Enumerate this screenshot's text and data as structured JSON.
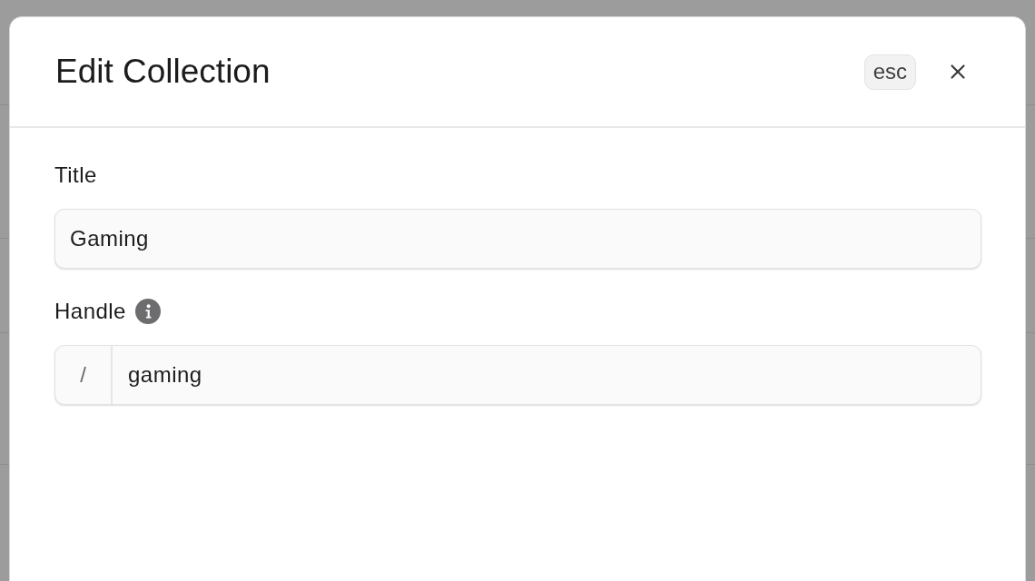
{
  "dialog": {
    "title": "Edit Collection",
    "shortcut": "esc"
  },
  "fields": [
    {
      "kind": "text",
      "label": "Title",
      "info": false,
      "value": "Gaming"
    },
    {
      "kind": "prefixed",
      "label": "Handle",
      "info": true,
      "prefix": "/",
      "value": "gaming"
    }
  ]
}
